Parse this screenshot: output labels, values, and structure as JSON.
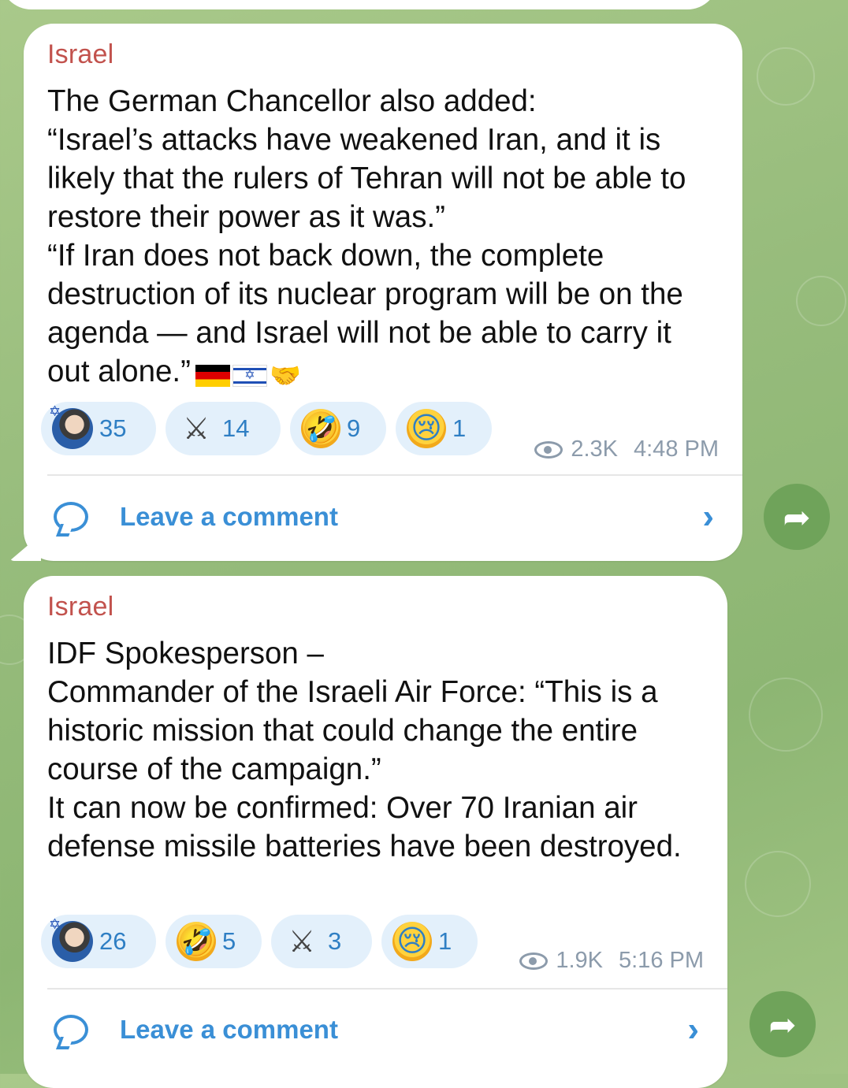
{
  "posts": [
    {
      "author": "Israel",
      "text": "The German Chancellor also added:\n“Israel’s attacks have weakened Iran, and it is likely that the rulers of Tehran will not be able to restore their power as it was.”\n“If Iran does not back down, the complete destruction of its nuclear program will be on the agenda — and Israel will not be able to carry it out alone.”",
      "trailing_emoji": [
        "flag-germany-icon",
        "flag-israel-icon",
        "handshake-icon"
      ],
      "reactions": [
        {
          "icon": "avatar-reaction-icon",
          "count": "35"
        },
        {
          "icon": "crossed-knives-icon",
          "count": "14"
        },
        {
          "icon": "rofl-emoji-icon",
          "count": "9"
        },
        {
          "icon": "crying-face-icon",
          "count": "1"
        }
      ],
      "views": "2.3K",
      "time": "4:48 PM",
      "comment_label": "Leave a comment"
    },
    {
      "author": "Israel",
      "text": "IDF Spokesperson –\nCommander of the Israeli Air Force: “This is a historic mission that could change the entire course of the campaign.”\nIt can now be confirmed: Over 70 Iranian air defense missile batteries have been destroyed.",
      "reactions": [
        {
          "icon": "avatar-reaction-icon",
          "count": "26"
        },
        {
          "icon": "rofl-emoji-icon",
          "count": "5"
        },
        {
          "icon": "crossed-knives-icon",
          "count": "3"
        },
        {
          "icon": "crying-face-icon",
          "count": "1"
        }
      ],
      "views": "1.9K",
      "time": "5:16 PM",
      "comment_label": "Leave a comment"
    }
  ],
  "colors": {
    "author": "#c2524d",
    "accent": "#3a8fd6",
    "reaction_bg": "#e3f0fb",
    "share_button": "#6fa35a",
    "chat_bg": "#9cbf7f"
  }
}
